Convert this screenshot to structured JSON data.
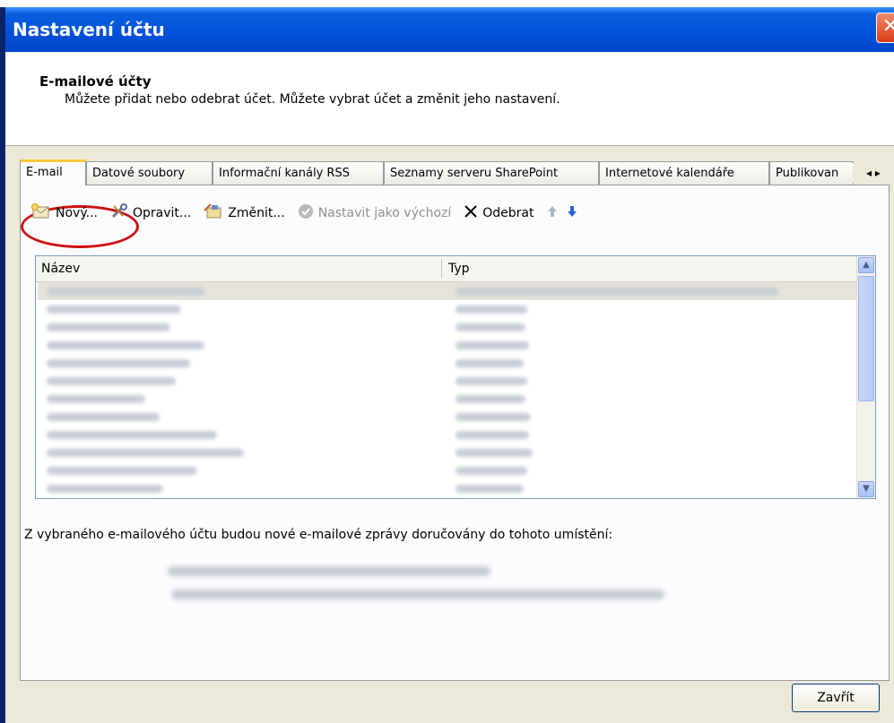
{
  "window": {
    "title": "Nastavení účtu",
    "close_symbol": "✕"
  },
  "header": {
    "title": "E-mailové účty",
    "description": "Můžete přidat nebo odebrat účet. Můžete vybrat účet a změnit jeho nastavení."
  },
  "tabs": [
    {
      "label": "E-mail",
      "active": true
    },
    {
      "label": "Datové soubory"
    },
    {
      "label": "Informační kanály RSS"
    },
    {
      "label": "Seznamy serveru SharePoint"
    },
    {
      "label": "Internetové kalendáře"
    },
    {
      "label": "Publikovan"
    }
  ],
  "tab_scroll": {
    "left": "◂",
    "right": "▸"
  },
  "toolbar": {
    "new_label": "Nový...",
    "repair_label": "Opravit...",
    "change_label": "Změnit...",
    "default_label": "Nastavit jako výchozí",
    "remove_label": "Odebrat",
    "up_symbol": "🡅",
    "down_symbol": "🡇"
  },
  "list": {
    "columns": [
      "Název",
      "Typ"
    ],
    "row_count": 12
  },
  "delivery": {
    "label": "Z vybraného e-mailového účtu budou nové e-mailové zprávy doručovány do tohoto umístění:"
  },
  "footer": {
    "close_label": "Zavřít"
  },
  "colors": {
    "title_bar": "#0050d8",
    "frame": "#0a246a",
    "highlight_ring": "#cc1010",
    "tab_accent": "#ffc83c"
  }
}
